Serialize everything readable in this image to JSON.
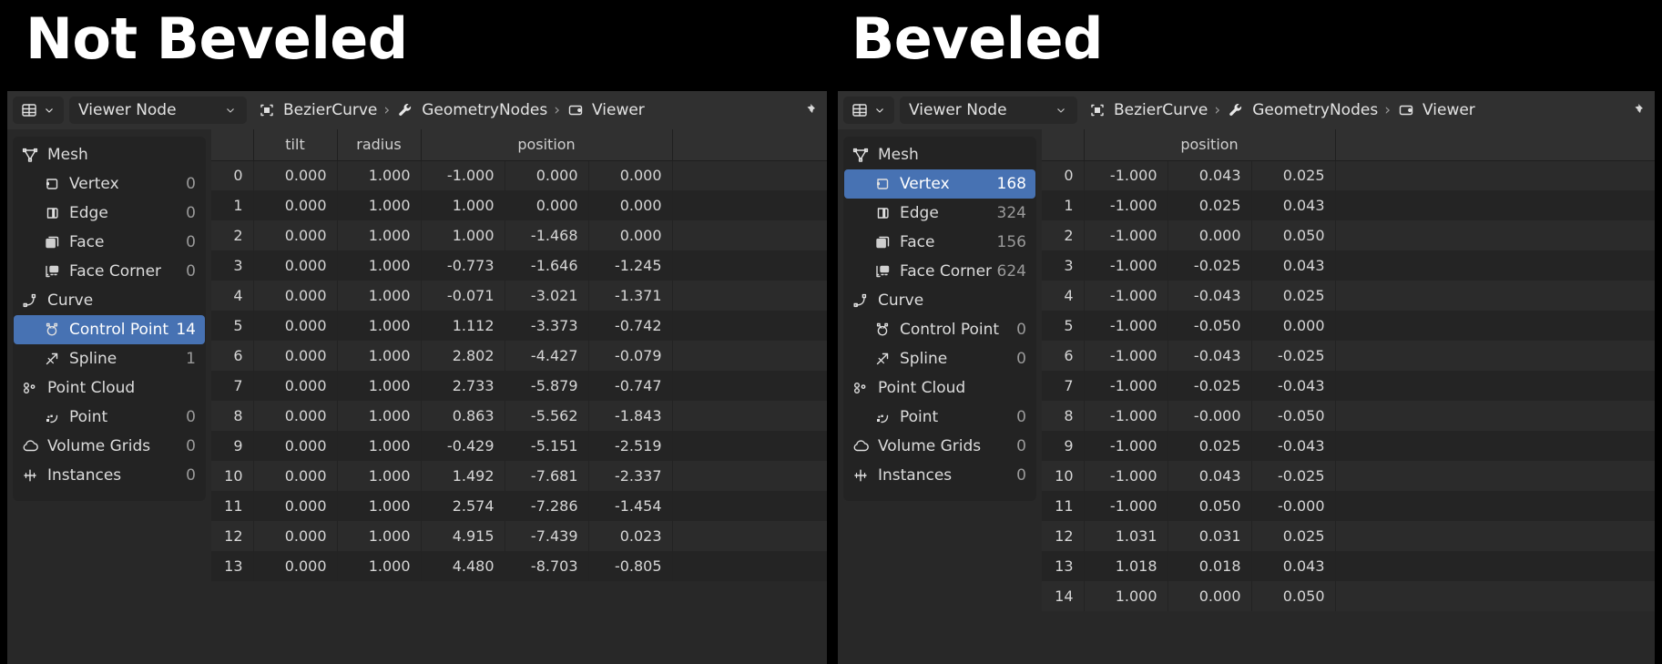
{
  "titles": {
    "left": "Not Beveled",
    "right": "Beveled"
  },
  "colors": {
    "accent": "#4772b3",
    "panel_bg": "#282828",
    "header_bg": "#303030",
    "tree_bg": "#232323",
    "row_odd": "#2b2b2b",
    "row_even": "#242424",
    "text": "#dcdcdc",
    "muted": "#9a9a9a",
    "page_bg": "#000000"
  },
  "panels": [
    {
      "id": "not-beveled",
      "header": {
        "editor_type_icon": "spreadsheet-editor-icon",
        "editor_type_chevron": "chevron-down-icon",
        "mode_label": "Viewer Node",
        "mode_chevron": "chevron-down-icon",
        "breadcrumbs": [
          {
            "icon": "object-data-icon",
            "label": "BezierCurve"
          },
          {
            "icon": "modifier-wrench-icon",
            "label": "GeometryNodes"
          },
          {
            "icon": "viewer-node-icon",
            "label": "Viewer"
          }
        ],
        "separator": "›",
        "pin_icon": "pin-icon"
      },
      "tree": [
        {
          "icon": "mesh-data-icon",
          "label": "Mesh",
          "count": "",
          "child": false,
          "selected": false
        },
        {
          "icon": "vertex-icon",
          "label": "Vertex",
          "count": "0",
          "child": true,
          "selected": false
        },
        {
          "icon": "edge-icon",
          "label": "Edge",
          "count": "0",
          "child": true,
          "selected": false
        },
        {
          "icon": "face-icon",
          "label": "Face",
          "count": "0",
          "child": true,
          "selected": false
        },
        {
          "icon": "face-corner-icon",
          "label": "Face Corner",
          "count": "0",
          "child": true,
          "selected": false
        },
        {
          "icon": "curve-data-icon",
          "label": "Curve",
          "count": "",
          "child": false,
          "selected": false
        },
        {
          "icon": "control-point-icon",
          "label": "Control Point",
          "count": "14",
          "child": true,
          "selected": true
        },
        {
          "icon": "spline-icon",
          "label": "Spline",
          "count": "1",
          "child": true,
          "selected": false
        },
        {
          "icon": "point-cloud-icon",
          "label": "Point Cloud",
          "count": "",
          "child": false,
          "selected": false
        },
        {
          "icon": "point-icon",
          "label": "Point",
          "count": "0",
          "child": true,
          "selected": false
        },
        {
          "icon": "volume-grids-icon",
          "label": "Volume Grids",
          "count": "0",
          "child": false,
          "selected": false
        },
        {
          "icon": "instances-icon",
          "label": "Instances",
          "count": "0",
          "child": false,
          "selected": false
        }
      ],
      "table": {
        "groups": [
          {
            "label": "",
            "span": 1
          },
          {
            "label": "tilt",
            "span": 1
          },
          {
            "label": "radius",
            "span": 1
          },
          {
            "label": "position",
            "span": 3
          },
          {
            "label": "",
            "span": 1
          }
        ],
        "rows": [
          {
            "index": "0",
            "tilt": "0.000",
            "radius": "1.000",
            "x": "-1.000",
            "y": "0.000",
            "z": "0.000"
          },
          {
            "index": "1",
            "tilt": "0.000",
            "radius": "1.000",
            "x": "1.000",
            "y": "0.000",
            "z": "0.000"
          },
          {
            "index": "2",
            "tilt": "0.000",
            "radius": "1.000",
            "x": "1.000",
            "y": "-1.468",
            "z": "0.000"
          },
          {
            "index": "3",
            "tilt": "0.000",
            "radius": "1.000",
            "x": "-0.773",
            "y": "-1.646",
            "z": "-1.245"
          },
          {
            "index": "4",
            "tilt": "0.000",
            "radius": "1.000",
            "x": "-0.071",
            "y": "-3.021",
            "z": "-1.371"
          },
          {
            "index": "5",
            "tilt": "0.000",
            "radius": "1.000",
            "x": "1.112",
            "y": "-3.373",
            "z": "-0.742"
          },
          {
            "index": "6",
            "tilt": "0.000",
            "radius": "1.000",
            "x": "2.802",
            "y": "-4.427",
            "z": "-0.079"
          },
          {
            "index": "7",
            "tilt": "0.000",
            "radius": "1.000",
            "x": "2.733",
            "y": "-5.879",
            "z": "-0.747"
          },
          {
            "index": "8",
            "tilt": "0.000",
            "radius": "1.000",
            "x": "0.863",
            "y": "-5.562",
            "z": "-1.843"
          },
          {
            "index": "9",
            "tilt": "0.000",
            "radius": "1.000",
            "x": "-0.429",
            "y": "-5.151",
            "z": "-2.519"
          },
          {
            "index": "10",
            "tilt": "0.000",
            "radius": "1.000",
            "x": "1.492",
            "y": "-7.681",
            "z": "-2.337"
          },
          {
            "index": "11",
            "tilt": "0.000",
            "radius": "1.000",
            "x": "2.574",
            "y": "-7.286",
            "z": "-1.454"
          },
          {
            "index": "12",
            "tilt": "0.000",
            "radius": "1.000",
            "x": "4.915",
            "y": "-7.439",
            "z": "0.023"
          },
          {
            "index": "13",
            "tilt": "0.000",
            "radius": "1.000",
            "x": "4.480",
            "y": "-8.703",
            "z": "-0.805"
          }
        ]
      }
    },
    {
      "id": "beveled",
      "header": {
        "editor_type_icon": "spreadsheet-editor-icon",
        "editor_type_chevron": "chevron-down-icon",
        "mode_label": "Viewer Node",
        "mode_chevron": "chevron-down-icon",
        "breadcrumbs": [
          {
            "icon": "object-data-icon",
            "label": "BezierCurve"
          },
          {
            "icon": "modifier-wrench-icon",
            "label": "GeometryNodes"
          },
          {
            "icon": "viewer-node-icon",
            "label": "Viewer"
          }
        ],
        "separator": "›",
        "pin_icon": "pin-icon"
      },
      "tree": [
        {
          "icon": "mesh-data-icon",
          "label": "Mesh",
          "count": "",
          "child": false,
          "selected": false
        },
        {
          "icon": "vertex-icon",
          "label": "Vertex",
          "count": "168",
          "child": true,
          "selected": true
        },
        {
          "icon": "edge-icon",
          "label": "Edge",
          "count": "324",
          "child": true,
          "selected": false
        },
        {
          "icon": "face-icon",
          "label": "Face",
          "count": "156",
          "child": true,
          "selected": false
        },
        {
          "icon": "face-corner-icon",
          "label": "Face Corner",
          "count": "624",
          "child": true,
          "selected": false
        },
        {
          "icon": "curve-data-icon",
          "label": "Curve",
          "count": "",
          "child": false,
          "selected": false
        },
        {
          "icon": "control-point-icon",
          "label": "Control Point",
          "count": "0",
          "child": true,
          "selected": false
        },
        {
          "icon": "spline-icon",
          "label": "Spline",
          "count": "0",
          "child": true,
          "selected": false
        },
        {
          "icon": "point-cloud-icon",
          "label": "Point Cloud",
          "count": "",
          "child": false,
          "selected": false
        },
        {
          "icon": "point-icon",
          "label": "Point",
          "count": "0",
          "child": true,
          "selected": false
        },
        {
          "icon": "volume-grids-icon",
          "label": "Volume Grids",
          "count": "0",
          "child": false,
          "selected": false
        },
        {
          "icon": "instances-icon",
          "label": "Instances",
          "count": "0",
          "child": false,
          "selected": false
        }
      ],
      "table": {
        "groups": [
          {
            "label": "",
            "span": 1
          },
          {
            "label": "position",
            "span": 3
          },
          {
            "label": "",
            "span": 1
          }
        ],
        "rows": [
          {
            "index": "0",
            "x": "-1.000",
            "y": "0.043",
            "z": "0.025"
          },
          {
            "index": "1",
            "x": "-1.000",
            "y": "0.025",
            "z": "0.043"
          },
          {
            "index": "2",
            "x": "-1.000",
            "y": "0.000",
            "z": "0.050"
          },
          {
            "index": "3",
            "x": "-1.000",
            "y": "-0.025",
            "z": "0.043"
          },
          {
            "index": "4",
            "x": "-1.000",
            "y": "-0.043",
            "z": "0.025"
          },
          {
            "index": "5",
            "x": "-1.000",
            "y": "-0.050",
            "z": "0.000"
          },
          {
            "index": "6",
            "x": "-1.000",
            "y": "-0.043",
            "z": "-0.025"
          },
          {
            "index": "7",
            "x": "-1.000",
            "y": "-0.025",
            "z": "-0.043"
          },
          {
            "index": "8",
            "x": "-1.000",
            "y": "-0.000",
            "z": "-0.050"
          },
          {
            "index": "9",
            "x": "-1.000",
            "y": "0.025",
            "z": "-0.043"
          },
          {
            "index": "10",
            "x": "-1.000",
            "y": "0.043",
            "z": "-0.025"
          },
          {
            "index": "11",
            "x": "-1.000",
            "y": "0.050",
            "z": "-0.000"
          },
          {
            "index": "12",
            "x": "1.031",
            "y": "0.031",
            "z": "0.025"
          },
          {
            "index": "13",
            "x": "1.018",
            "y": "0.018",
            "z": "0.043"
          },
          {
            "index": "14",
            "x": "1.000",
            "y": "0.000",
            "z": "0.050"
          }
        ]
      }
    }
  ]
}
